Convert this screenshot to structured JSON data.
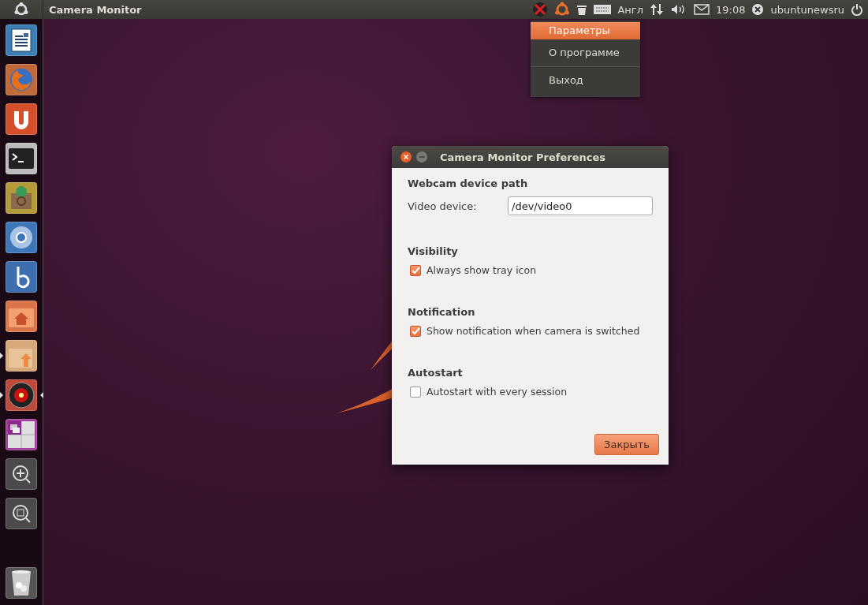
{
  "top_panel": {
    "app_title": "Camera Monitor",
    "tray": {
      "keyboard": "Англ",
      "clock": "19:08",
      "user": "ubuntunewsru"
    }
  },
  "indicator_menu": {
    "items": [
      {
        "label": "Параметры",
        "selected": true
      },
      {
        "label": "О программе",
        "selected": false
      },
      {
        "label": "Выход",
        "selected": false
      }
    ]
  },
  "launcher": {
    "items": [
      {
        "kind": "writer",
        "running": false,
        "focused": false
      },
      {
        "kind": "firefox",
        "running": false,
        "focused": false
      },
      {
        "kind": "ubuntuone",
        "running": false,
        "focused": false
      },
      {
        "kind": "terminal",
        "running": false,
        "focused": false
      },
      {
        "kind": "software",
        "running": false,
        "focused": false
      },
      {
        "kind": "chromium",
        "running": false,
        "focused": false
      },
      {
        "kind": "bluefish",
        "running": false,
        "focused": false
      },
      {
        "kind": "home",
        "running": false,
        "focused": false
      },
      {
        "kind": "installer",
        "running": true,
        "focused": false
      },
      {
        "kind": "camera",
        "running": true,
        "focused": true
      },
      {
        "kind": "workspaces",
        "running": false,
        "focused": false
      },
      {
        "kind": "zoomin",
        "running": false,
        "focused": false
      },
      {
        "kind": "zoom",
        "running": false,
        "focused": false
      }
    ],
    "trash": {
      "kind": "trash"
    }
  },
  "dialog": {
    "title": "Camera Monitor Preferences",
    "sections": [
      {
        "heading": "Webcam device path",
        "kind": "field",
        "label": "Video device:",
        "value": "/dev/video0"
      },
      {
        "heading": "Visibility",
        "kind": "checkbox",
        "label": "Always show tray icon",
        "checked": true
      },
      {
        "heading": "Notification",
        "kind": "checkbox",
        "label": "Show notification when camera is switched",
        "checked": true
      },
      {
        "heading": "Autostart",
        "kind": "checkbox",
        "label": "Autostart with every session",
        "checked": false
      }
    ],
    "button": "Закрыть"
  }
}
